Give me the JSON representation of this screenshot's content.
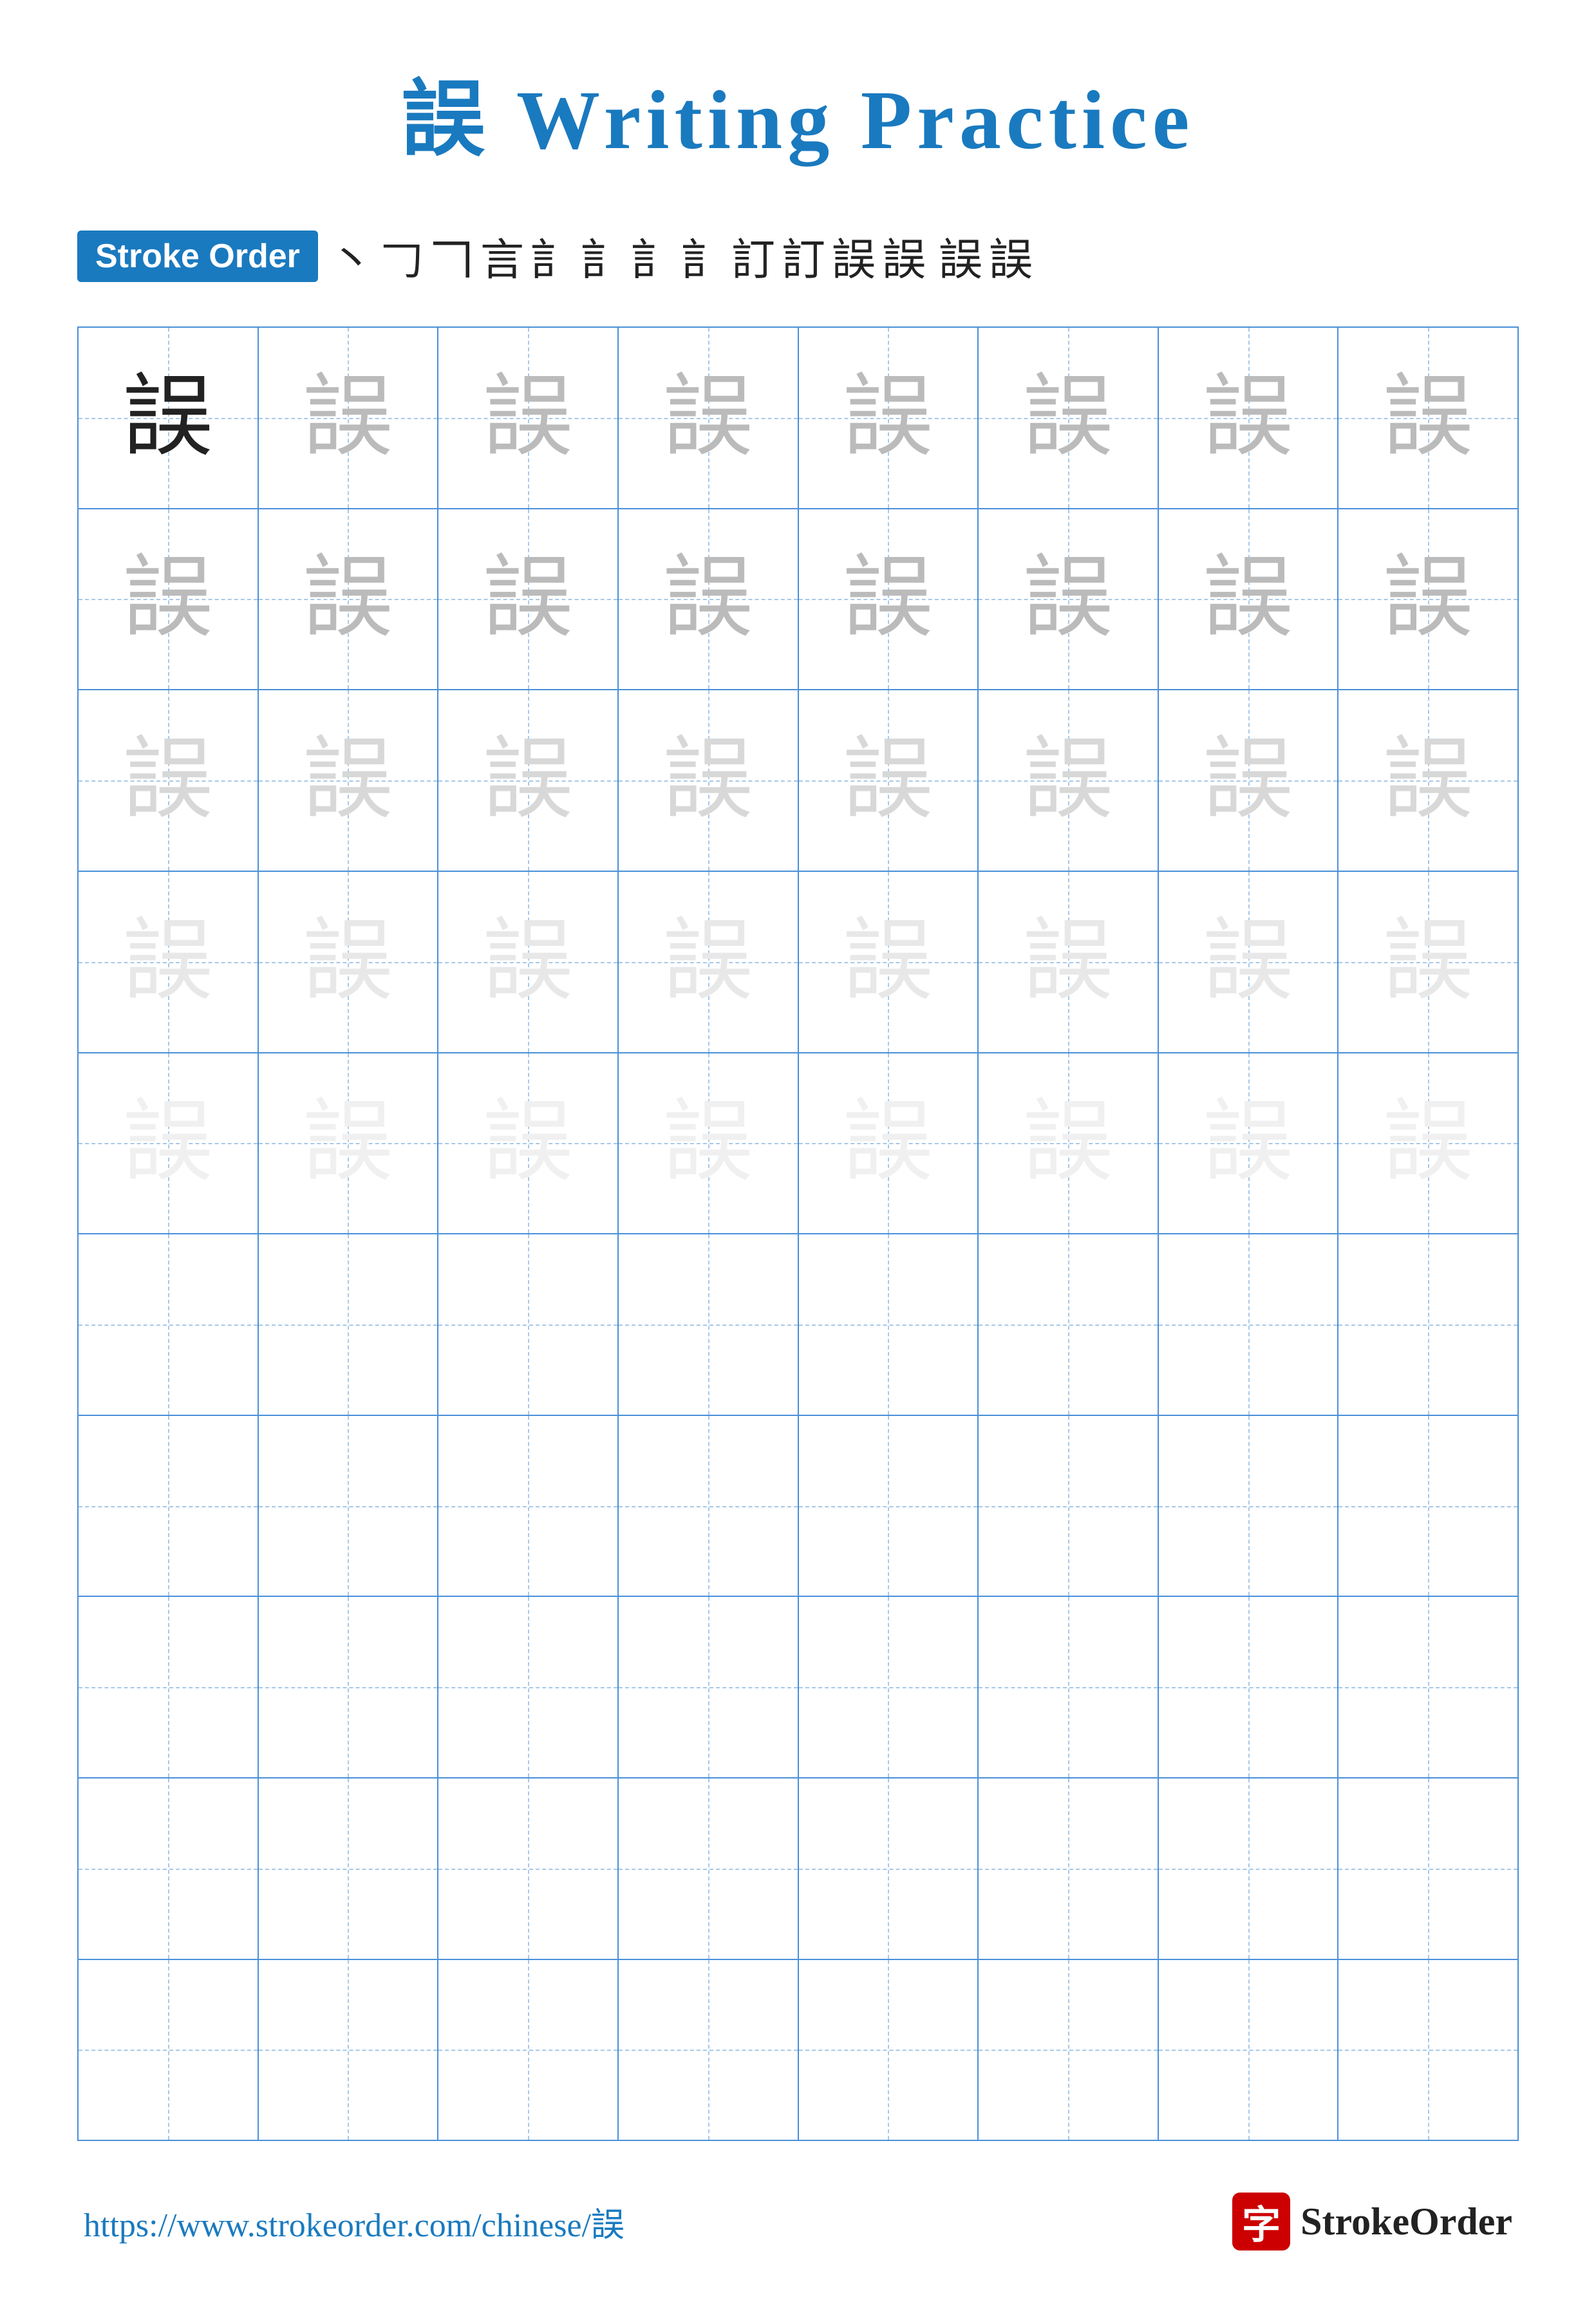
{
  "title": "誤 Writing Practice",
  "stroke_order": {
    "badge_label": "Stroke Order",
    "characters": [
      "丶",
      "𠃌",
      "𠃍",
      "言",
      "訁",
      "訁",
      "訁",
      "訁",
      "訂",
      "訂",
      "誤",
      "誤",
      "誤",
      "誤"
    ]
  },
  "character": "誤",
  "grid": {
    "cols": 8,
    "rows": [
      {
        "shades": [
          "dark",
          "medium",
          "medium",
          "medium",
          "medium",
          "medium",
          "medium",
          "medium"
        ]
      },
      {
        "shades": [
          "medium",
          "medium",
          "medium",
          "medium",
          "medium",
          "medium",
          "medium",
          "medium"
        ]
      },
      {
        "shades": [
          "light",
          "light",
          "light",
          "light",
          "light",
          "light",
          "light",
          "light"
        ]
      },
      {
        "shades": [
          "very-light",
          "very-light",
          "very-light",
          "very-light",
          "very-light",
          "very-light",
          "very-light",
          "very-light"
        ]
      },
      {
        "shades": [
          "faint",
          "faint",
          "faint",
          "faint",
          "faint",
          "faint",
          "faint",
          "faint"
        ]
      },
      {
        "shades": [
          "empty",
          "empty",
          "empty",
          "empty",
          "empty",
          "empty",
          "empty",
          "empty"
        ]
      },
      {
        "shades": [
          "empty",
          "empty",
          "empty",
          "empty",
          "empty",
          "empty",
          "empty",
          "empty"
        ]
      },
      {
        "shades": [
          "empty",
          "empty",
          "empty",
          "empty",
          "empty",
          "empty",
          "empty",
          "empty"
        ]
      },
      {
        "shades": [
          "empty",
          "empty",
          "empty",
          "empty",
          "empty",
          "empty",
          "empty",
          "empty"
        ]
      },
      {
        "shades": [
          "empty",
          "empty",
          "empty",
          "empty",
          "empty",
          "empty",
          "empty",
          "empty"
        ]
      }
    ]
  },
  "footer": {
    "url": "https://www.strokeorder.com/chinese/誤",
    "logo_text": "StrokeOrder",
    "logo_char": "字"
  }
}
